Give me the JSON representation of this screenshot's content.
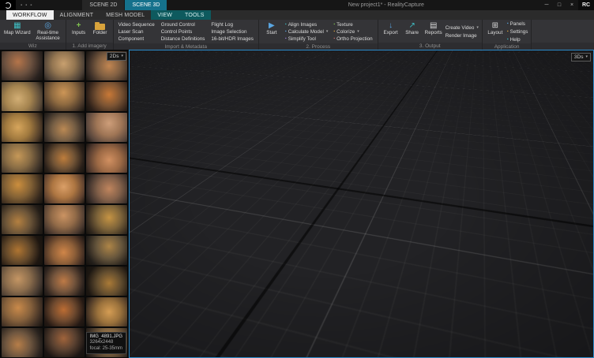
{
  "titlebar": {
    "scene_tabs": [
      {
        "label": "SCENE 2D"
      },
      {
        "label": "SCENE 3D"
      }
    ],
    "title": "New project1* - RealityCapture",
    "rc_mark": "RC"
  },
  "icons": {
    "dropdown": "▾",
    "minimize": "─",
    "maximize": "□",
    "close": "×",
    "bullet": "▪",
    "map_wizard": "▦",
    "assistance": "◎",
    "inputs": "+",
    "start": "▶",
    "export": "↓",
    "share": "↗",
    "reports": "▤",
    "layout": "⊞"
  },
  "ribbon_tabs": [
    {
      "label": "WORKFLOW"
    },
    {
      "label": "ALIGNMENT"
    },
    {
      "label": "MESH MODEL"
    },
    {
      "label": "VIEW"
    },
    {
      "label": "TOOLS"
    }
  ],
  "wiz": {
    "caption": "Wiz",
    "map_wizard": "Map Wizard",
    "realtime": "Real-time Assistance"
  },
  "add_imagery": {
    "caption": "1. Add imagery",
    "inputs": "Inputs",
    "folder": "Folder"
  },
  "import_meta": {
    "caption": "Import & Metadata",
    "items": [
      "Video Sequence",
      "Laser Scan",
      "Component",
      "Ground Control",
      "Control Points",
      "Distance Definitions",
      "Flight Log",
      "Image Selection",
      "16-bit/HDR Images"
    ]
  },
  "process": {
    "caption": "2. Process",
    "start": "Start",
    "items": [
      {
        "label": "Align Images"
      },
      {
        "label": "Calculate Model",
        "dropdown": true
      },
      {
        "label": "Simplify Tool"
      },
      {
        "label": "Texture"
      },
      {
        "label": "Colorize",
        "dropdown": true
      },
      {
        "label": "Ortho Projection"
      }
    ]
  },
  "output": {
    "caption": "3. Output",
    "export": "Export",
    "share": "Share",
    "reports": "Reports",
    "create_video": "Create Video",
    "render_image": "Render Image"
  },
  "application": {
    "caption": "Application",
    "layout": "Layout",
    "panels": "Panels",
    "settings": "Settings",
    "help": "Help"
  },
  "left_panel": {
    "badge": "2Ds",
    "thumb_count": 30,
    "tooltip": {
      "filename": "IMG_4891.JPG",
      "resolution": "3264x2448",
      "focal": "focal: 25-35mm"
    }
  },
  "viewport": {
    "badge": "3Ds"
  },
  "colors": {
    "viewport_border": "#2b8ac9",
    "scene_tab_active": "#15718c",
    "accent_tab_bg": "#0e5a5e",
    "selected_tab_bg": "#efefef"
  }
}
